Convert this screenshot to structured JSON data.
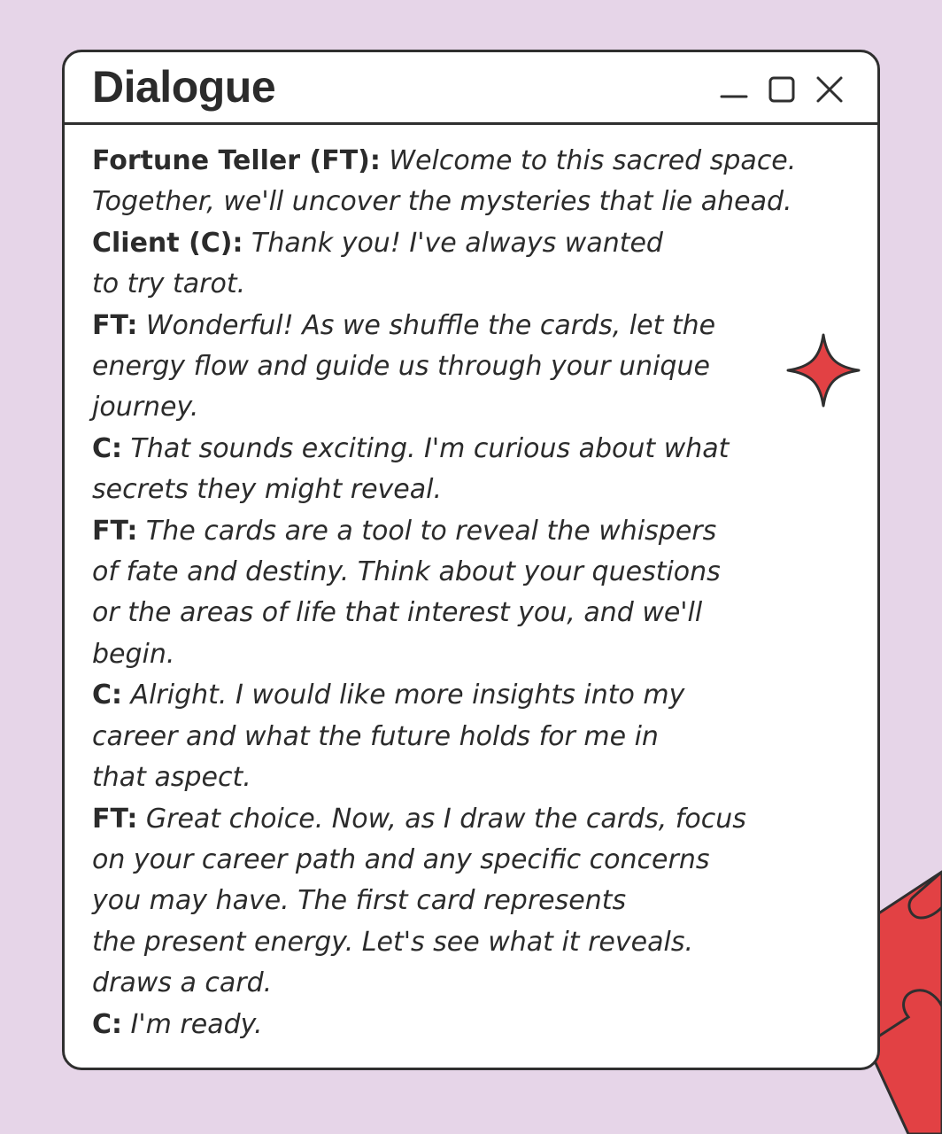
{
  "window": {
    "title": "Dialogue"
  },
  "colors": {
    "background": "#e6d5e8",
    "accent": "#e24144",
    "border": "#2f2f2f"
  },
  "icons": {
    "minimize": "minimize-icon",
    "maximize": "maximize-icon",
    "close": "close-icon",
    "decoration": "four-point-star-icon"
  },
  "dialogue": [
    {
      "speaker": "Fortune Teller (FT):",
      "text": " Welcome to this sacred space."
    },
    {
      "speaker": "",
      "text": "Together, we'll uncover the mysteries that lie ahead."
    },
    {
      "speaker": "Client (C):",
      "text": " Thank you! I've always wanted"
    },
    {
      "speaker": "",
      "text": "to try tarot."
    },
    {
      "speaker": "FT:",
      "text": " Wonderful! As we shuffle the cards, let the"
    },
    {
      "speaker": "",
      "text": "energy flow and guide us through your unique"
    },
    {
      "speaker": "",
      "text": "journey."
    },
    {
      "speaker": "C:",
      "text": " That sounds exciting. I'm curious about what"
    },
    {
      "speaker": "",
      "text": "secrets they might reveal."
    },
    {
      "speaker": "FT:",
      "text": " The cards are a tool to reveal the whispers"
    },
    {
      "speaker": "",
      "text": "of fate and destiny. Think about your questions"
    },
    {
      "speaker": "",
      "text": "or the areas of life that interest you, and we'll"
    },
    {
      "speaker": "",
      "text": "begin."
    },
    {
      "speaker": "C:",
      "text": " Alright. I would like more insights into my"
    },
    {
      "speaker": "",
      "text": "career and what the future holds for me in"
    },
    {
      "speaker": "",
      "text": "that aspect."
    },
    {
      "speaker": "FT:",
      "text": " Great choice. Now, as I draw the cards, focus"
    },
    {
      "speaker": "",
      "text": "on your career path and any specific concerns"
    },
    {
      "speaker": "",
      "text": "you may have. The first card represents"
    },
    {
      "speaker": "",
      "text": "the present energy. Let's see what it reveals."
    },
    {
      "speaker": "",
      "text": "draws a card."
    },
    {
      "speaker": "C:",
      "text": " I'm ready."
    }
  ]
}
